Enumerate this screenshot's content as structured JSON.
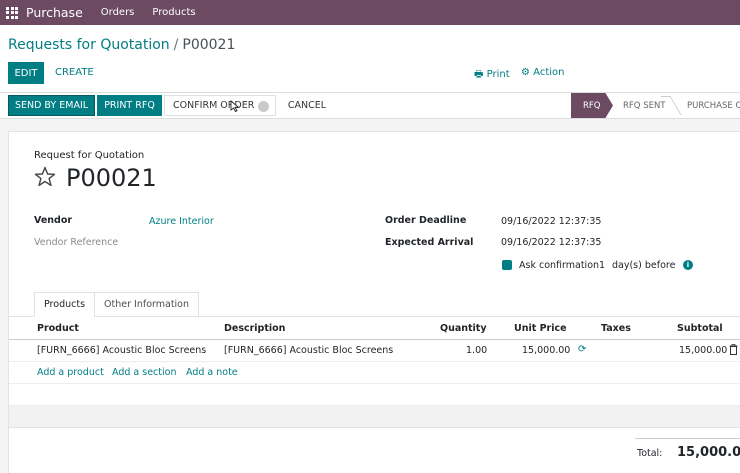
{
  "topbar": {
    "app_name": "Purchase",
    "menu": [
      "Orders",
      "Products"
    ],
    "bg_color": "#6b4a62"
  },
  "breadcrumb": {
    "parent": "Requests for Quotation",
    "separator": "/",
    "current": "P00021"
  },
  "toolbar": {
    "edit_label": "EDIT",
    "create_label": "CREATE",
    "print_label": "Print",
    "action_label": "Action"
  },
  "statusbar": {
    "send_label": "SEND BY EMAIL",
    "print_rfq_label": "PRINT RFQ",
    "confirm_label": "CONFIRM ORDER",
    "cancel_label": "CANCEL",
    "stages": [
      "RFQ",
      "RFQ SENT",
      "PURCHASE O"
    ],
    "active_stage": "RFQ"
  },
  "form": {
    "doc_type": "Request for Quotation",
    "doc_name": "P00021",
    "vendor_label": "Vendor",
    "vendor_value": "Azure Interior",
    "vendor_ref_label": "Vendor Reference",
    "deadline_label": "Order Deadline",
    "deadline_value": "09/16/2022 12:37:35",
    "arrival_label": "Expected Arrival",
    "arrival_value": "09/16/2022 12:37:35",
    "ask_confirm_label": "Ask confirmation",
    "ask_confirm_days": "1",
    "ask_confirm_suffix": "day(s) before",
    "ask_confirm_checked": true
  },
  "tabs": [
    "Products",
    "Other Information"
  ],
  "table": {
    "columns": [
      "Product",
      "Description",
      "Quantity",
      "Unit Price",
      "Taxes",
      "Subtotal"
    ],
    "rows": [
      {
        "product": "[FURN_6666] Acoustic Bloc Screens",
        "description": "[FURN_6666] Acoustic Bloc Screens",
        "quantity": "1.00",
        "unit_price": "15,000.00",
        "taxes": "",
        "subtotal": "15,000.00"
      }
    ],
    "add_links": [
      "Add a product",
      "Add a section",
      "Add a note"
    ]
  },
  "totals": {
    "label": "Total:",
    "value": "15,000.00"
  },
  "colors": {
    "accent": "#017e84",
    "brand": "#6b4a62"
  }
}
